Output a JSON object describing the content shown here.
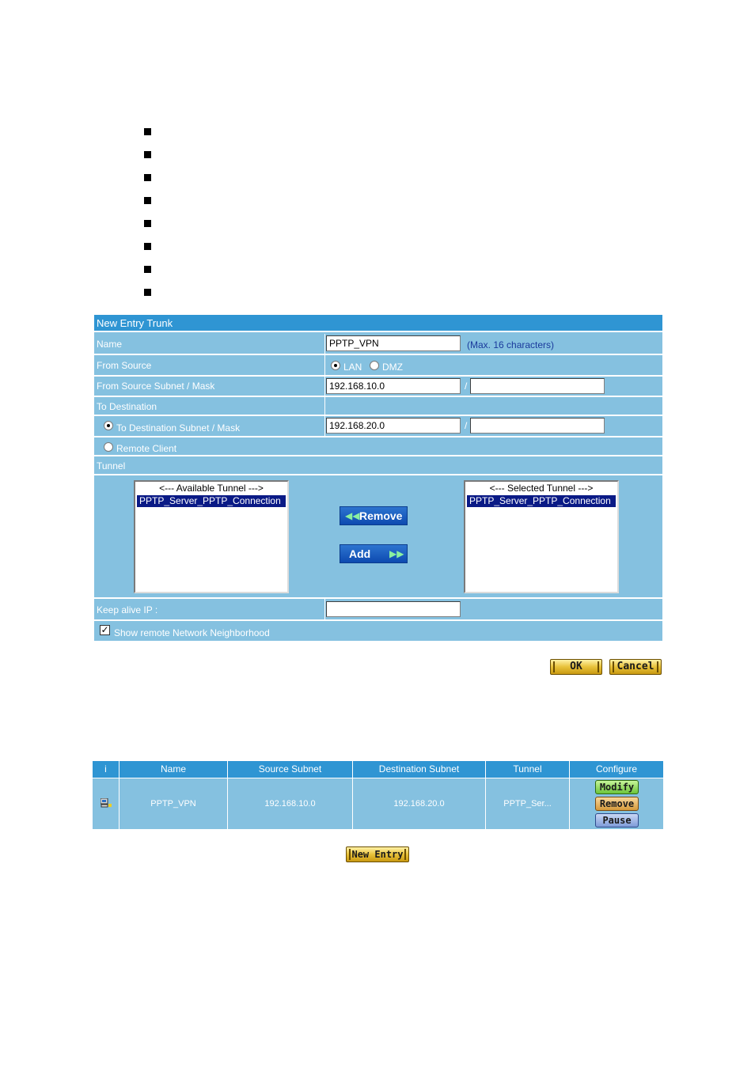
{
  "form": {
    "title": "New Entry Trunk",
    "name": {
      "label": "Name",
      "value": "PPTP_VPN",
      "note": "(Max. 16 characters)"
    },
    "from_source": {
      "label": "From Source",
      "options": [
        "LAN",
        "DMZ"
      ],
      "selected": "LAN"
    },
    "from_source_subnet": {
      "label": "From Source Subnet / Mask",
      "subnet": "192.168.10.0",
      "mask": "",
      "slash": "/"
    },
    "to_destination": {
      "label": "To Destination"
    },
    "to_destination_subnet": {
      "label": "To Destination Subnet / Mask",
      "subnet": "192.168.20.0",
      "mask": "",
      "slash": "/",
      "selected": true
    },
    "remote_client": {
      "label": "Remote Client",
      "selected": false
    },
    "tunnel": {
      "label": "Tunnel",
      "available_header": "<--- Available Tunnel --->",
      "available_items": [
        "PPTP_Server_PPTP_Connection"
      ],
      "selected_header": "<--- Selected Tunnel --->",
      "selected_items": [
        "PPTP_Server_PPTP_Connection"
      ],
      "remove_label": "Remove",
      "add_label": "Add"
    },
    "keep_alive": {
      "label": "Keep alive IP :",
      "value": ""
    },
    "show_neighborhood": {
      "label": "Show remote Network Neighborhood",
      "checked": true
    },
    "ok_label": "OK",
    "cancel_label": "Cancel"
  },
  "table": {
    "headers": [
      "i",
      "Name",
      "Source Subnet",
      "Destination Subnet",
      "Tunnel",
      "Configure"
    ],
    "rows": [
      {
        "name": "PPTP_VPN",
        "source": "192.168.10.0",
        "destination": "192.168.20.0",
        "tunnel": "PPTP_Ser..."
      }
    ],
    "modify_label": "Modify",
    "remove_label": "Remove",
    "pause_label": "Pause",
    "new_entry_label": "New Entry"
  },
  "colors": {
    "panel_bg": "#85c1e0",
    "header_bg": "#2f95d3",
    "note": "#1a3a9c",
    "selection": "#0a1a86"
  },
  "icons": [
    "bullet-square",
    "radio",
    "checkbox",
    "double-left-arrow-icon",
    "double-right-arrow-icon",
    "computer-icon"
  ]
}
